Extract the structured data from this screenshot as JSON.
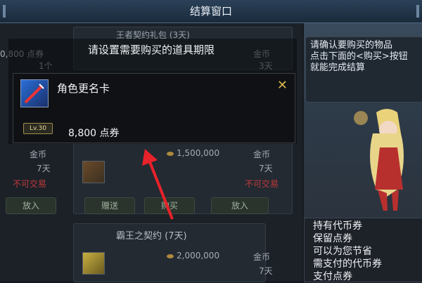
{
  "window": {
    "title": "结算窗口"
  },
  "dialog": {
    "prompt": "请设置需要购买的道具期限",
    "item": {
      "name": "角色更名卡",
      "level_badge": "Lv.30",
      "price": "8,800 点券"
    }
  },
  "shop": {
    "cells": [
      {
        "name": "王者契约礼包 (3天)",
        "price_top": "0,800 点券",
        "qty": "1个",
        "gold_price": "金币",
        "gold_days": "3天"
      },
      {
        "name": "",
        "price_gold": "1,500,000",
        "gold_label": "金币",
        "days": "7天",
        "status": "不可交易",
        "status_left": "不可交易"
      },
      {
        "name": "霸王之契约 (7天)",
        "price_gold": "2,000,000",
        "gold_label": "金币",
        "days": "7天"
      }
    ],
    "buttons": {
      "buy_left": "放入",
      "gift": "赠送",
      "buy": "购买",
      "cart": "放入"
    },
    "left_price": "金币",
    "left_days": "7天"
  },
  "info": {
    "top_text": "请确认要购买的物品\n点击下面的<购买>按钮\n就能完成结算",
    "bottom_text": "持有代币券\n保留点券\n可以为您节省\n需支付的代币券\n支付点券"
  }
}
